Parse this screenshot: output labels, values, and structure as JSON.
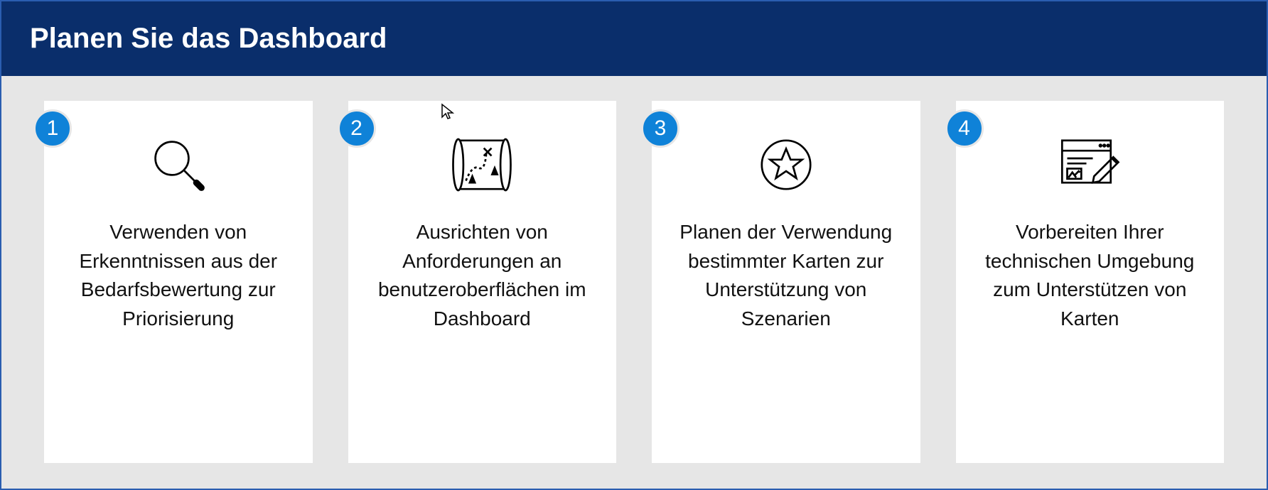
{
  "header": {
    "title": "Planen Sie das Dashboard"
  },
  "cards": [
    {
      "number": "1",
      "icon": "magnifier-icon",
      "text": "Verwenden von Erkenntnissen aus der Bedarfsbewertung zur Priorisierung"
    },
    {
      "number": "2",
      "icon": "map-icon",
      "text": "Ausrichten von Anforderungen an benutzer­oberflächen im Dashboard"
    },
    {
      "number": "3",
      "icon": "star-circle-icon",
      "text": "Planen der Verwendung bestimmter Karten zur Unterstützung von Szenarien"
    },
    {
      "number": "4",
      "icon": "design-window-icon",
      "text": "Vorbereiten Ihrer technischen Umgebung zum Unterstützen von Karten"
    }
  ],
  "colors": {
    "headerBg": "#0a2e6b",
    "bodyBg": "#e6e6e6",
    "badgeBg": "#0f82d8",
    "border": "#2a5db0"
  }
}
